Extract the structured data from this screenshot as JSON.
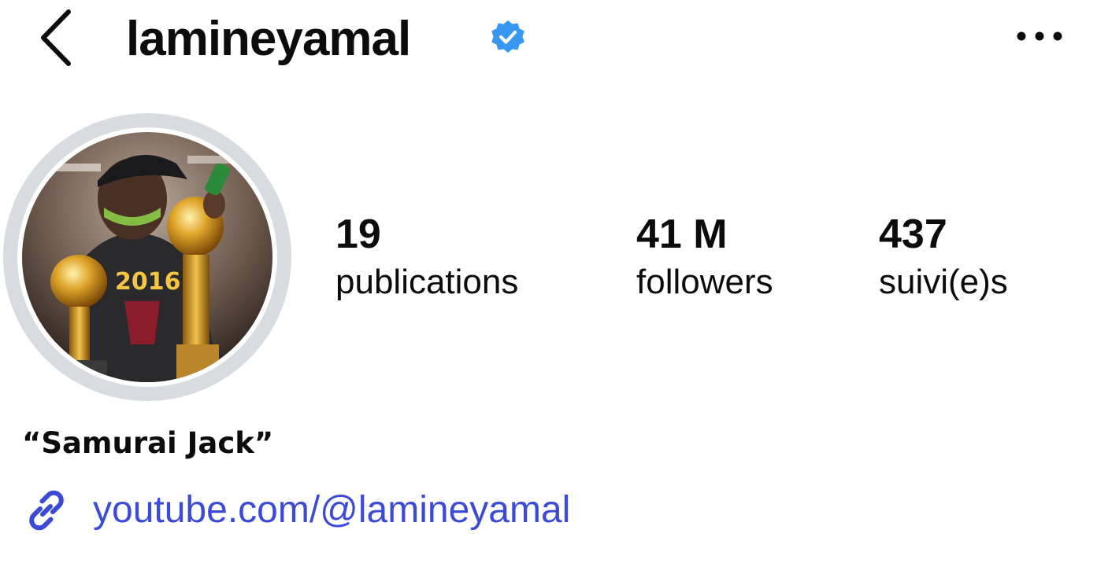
{
  "header": {
    "username": "lamineyamal",
    "verified": true,
    "back_icon": "chevron-left-icon",
    "more_icon": "more-horizontal-icon"
  },
  "profile": {
    "avatar_icon": "profile-photo",
    "stats": {
      "posts": {
        "count": "19",
        "label": "publications"
      },
      "followers": {
        "count": "41 M",
        "label": "followers"
      },
      "following": {
        "count": "437",
        "label": "suivi(e)s"
      }
    },
    "display_name": "“Samurai Jack”",
    "link": {
      "icon": "link-icon",
      "text": "youtube.com/@lamineyamal"
    }
  },
  "colors": {
    "verified_badge": "#3897f0",
    "link_text": "#3c4bd6",
    "avatar_ring": "#d8dbe0",
    "text": "#0c0c0c"
  }
}
